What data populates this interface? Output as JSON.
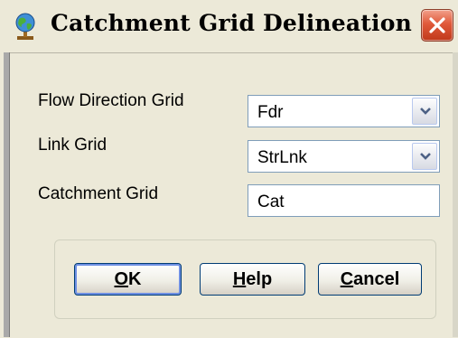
{
  "window": {
    "title": "Catchment Grid Delineation",
    "app_icon": "globe-icon",
    "close_icon": "close-icon"
  },
  "fields": {
    "flow_direction": {
      "label": "Flow Direction Grid",
      "value": "Fdr"
    },
    "link": {
      "label": "Link Grid",
      "value": "StrLnk"
    },
    "catchment": {
      "label": "Catchment Grid",
      "value": "Cat"
    }
  },
  "buttons": {
    "ok": "OK",
    "help": "Help",
    "cancel": "Cancel"
  },
  "colors": {
    "dialog_bg": "#ece9d8",
    "close_button": "#e0593a",
    "input_border": "#7f9db9",
    "button_border": "#003c74"
  }
}
